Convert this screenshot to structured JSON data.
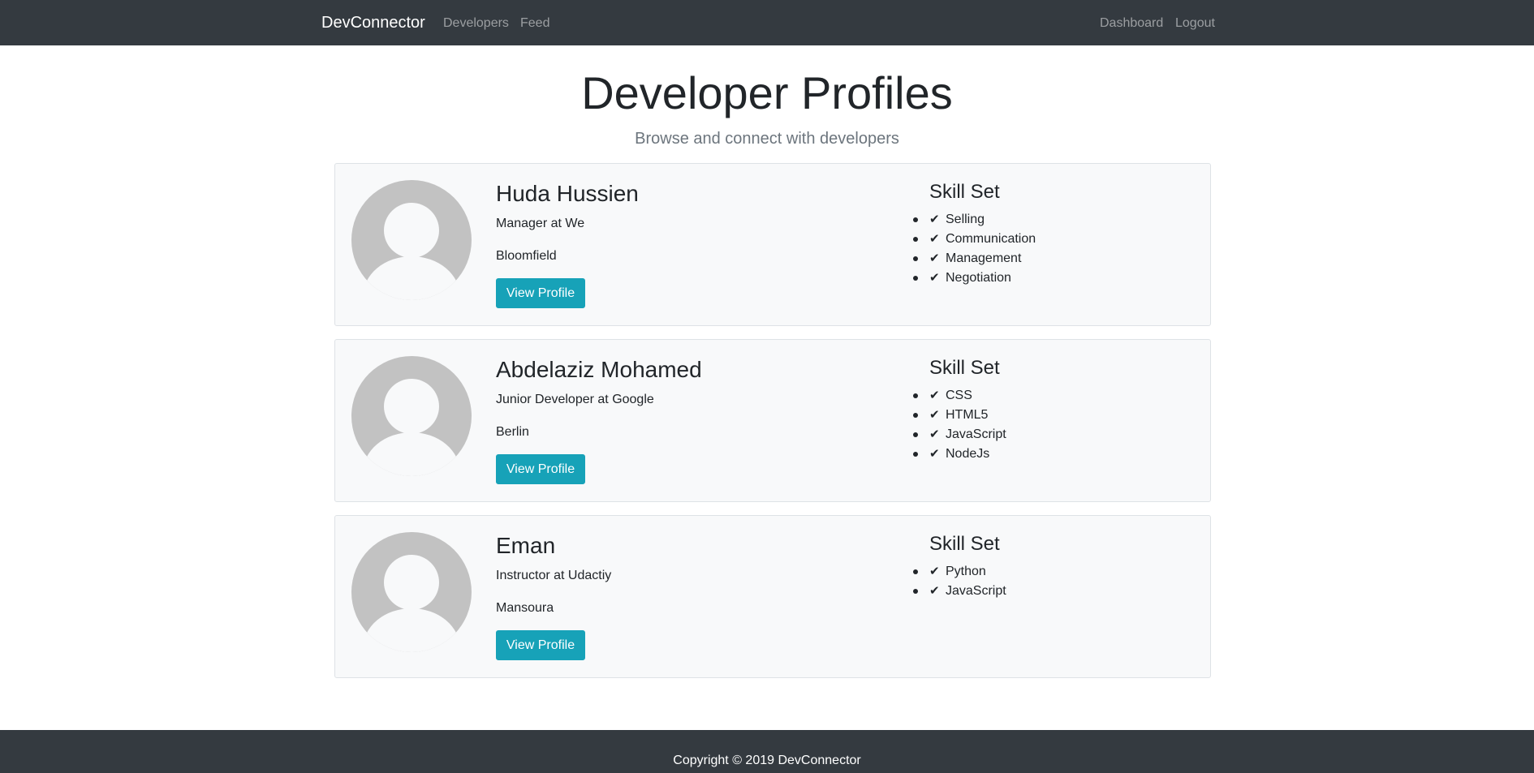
{
  "navbar": {
    "brand": "DevConnector",
    "links_left": [
      "Developers",
      "Feed"
    ],
    "links_right": [
      "Dashboard",
      "Logout"
    ]
  },
  "header": {
    "title": "Developer Profiles",
    "lead": "Browse and connect with developers"
  },
  "profiles": [
    {
      "name": "Huda Hussien",
      "status": "Manager at We",
      "location": "Bloomfield",
      "button_label": "View Profile",
      "skills_title": "Skill Set",
      "skills": [
        "Selling",
        "Communication",
        "Management",
        "Negotiation"
      ]
    },
    {
      "name": "Abdelaziz Mohamed",
      "status": "Junior Developer at Google",
      "location": "Berlin",
      "button_label": "View Profile",
      "skills_title": "Skill Set",
      "skills": [
        "CSS",
        "HTML5",
        "JavaScript",
        "NodeJs"
      ]
    },
    {
      "name": "Eman",
      "status": "Instructor at Udactiy",
      "location": "Mansoura",
      "button_label": "View Profile",
      "skills_title": "Skill Set",
      "skills": [
        "Python",
        "JavaScript"
      ]
    }
  ],
  "footer": {
    "text": "Copyright © 2019 DevConnector"
  },
  "colors": {
    "navbar_bg": "#343a40",
    "card_bg": "#f8f9fa",
    "button_bg": "#17a2b8"
  }
}
